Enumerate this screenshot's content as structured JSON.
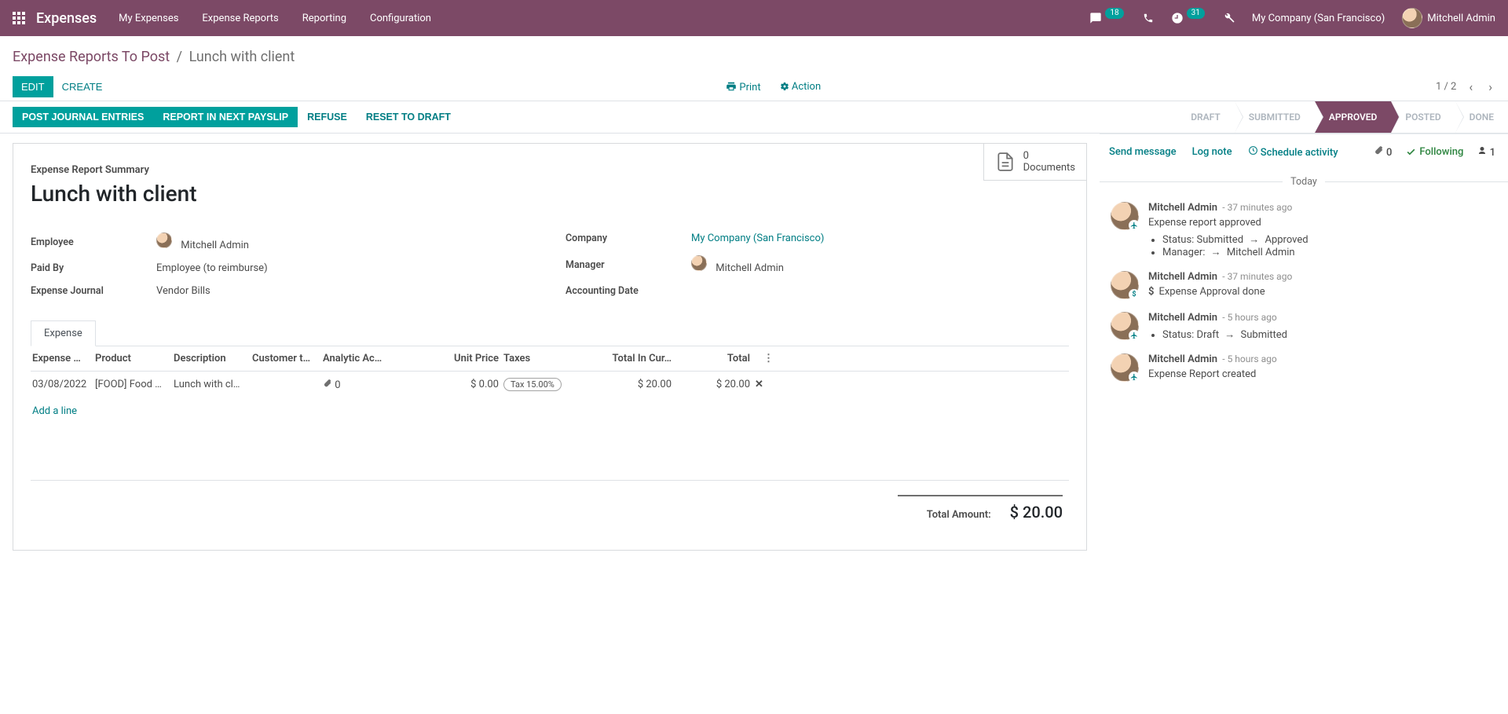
{
  "navbar": {
    "brand": "Expenses",
    "links": [
      "My Expenses",
      "Expense Reports",
      "Reporting",
      "Configuration"
    ],
    "msg_badge": "18",
    "activity_badge": "31",
    "company": "My Company (San Francisco)",
    "user": "Mitchell Admin"
  },
  "breadcrumb": {
    "parent": "Expense Reports To Post",
    "current": "Lunch with client"
  },
  "cp": {
    "edit": "EDIT",
    "create": "CREATE",
    "print": "Print",
    "action": "Action",
    "pager": "1 / 2"
  },
  "statusbar": {
    "buttons": [
      "POST JOURNAL ENTRIES",
      "REPORT IN NEXT PAYSLIP",
      "REFUSE",
      "RESET TO DRAFT"
    ],
    "steps": [
      "DRAFT",
      "SUBMITTED",
      "APPROVED",
      "POSTED",
      "DONE"
    ],
    "active_step": "APPROVED"
  },
  "statbtn": {
    "count": "0",
    "label": "Documents"
  },
  "sheet": {
    "section_label": "Expense Report Summary",
    "title": "Lunch with client",
    "employee_label": "Employee",
    "employee": "Mitchell Admin",
    "paidby_label": "Paid By",
    "paidby": "Employee (to reimburse)",
    "journal_label": "Expense Journal",
    "journal": "Vendor Bills",
    "company_label": "Company",
    "company": "My Company (San Francisco)",
    "manager_label": "Manager",
    "manager": "Mitchell Admin",
    "accdate_label": "Accounting Date",
    "accdate": ""
  },
  "notebook": {
    "tab": "Expense"
  },
  "table": {
    "headers": [
      "Expense …",
      "Product",
      "Description",
      "Customer t…",
      "Analytic Ac…",
      "Unit Price",
      "Taxes",
      "Total In Cur…",
      "Total"
    ],
    "row": {
      "date": "03/08/2022",
      "product": "[FOOD] Food …",
      "desc": "Lunch with cl…",
      "attach_count": "0",
      "unit_price": "$ 0.00",
      "tax": "Tax 15.00%",
      "total_cur": "$ 20.00",
      "total": "$ 20.00"
    },
    "add_line": "Add a line"
  },
  "total": {
    "label": "Total Amount:",
    "amount": "$ 20.00"
  },
  "chatter": {
    "send": "Send message",
    "log": "Log note",
    "schedule": "Schedule activity",
    "attach_count": "0",
    "following": "Following",
    "follower_count": "1",
    "today": "Today",
    "messages": [
      {
        "who": "Mitchell Admin",
        "when": "- 37 minutes ago",
        "line": "Expense report approved",
        "changes": [
          "Status: Submitted → Approved",
          "Manager:  → Mitchell Admin"
        ],
        "sub_icon": "plane"
      },
      {
        "who": "Mitchell Admin",
        "when": "- 37 minutes ago",
        "line": "Expense Approval done",
        "changes": [],
        "sub_icon": "dollar"
      },
      {
        "who": "Mitchell Admin",
        "when": "- 5 hours ago",
        "line": "",
        "changes": [
          "Status: Draft → Submitted"
        ],
        "sub_icon": "plane"
      },
      {
        "who": "Mitchell Admin",
        "when": "- 5 hours ago",
        "line": "Expense Report created",
        "changes": [],
        "sub_icon": "plane"
      }
    ]
  }
}
